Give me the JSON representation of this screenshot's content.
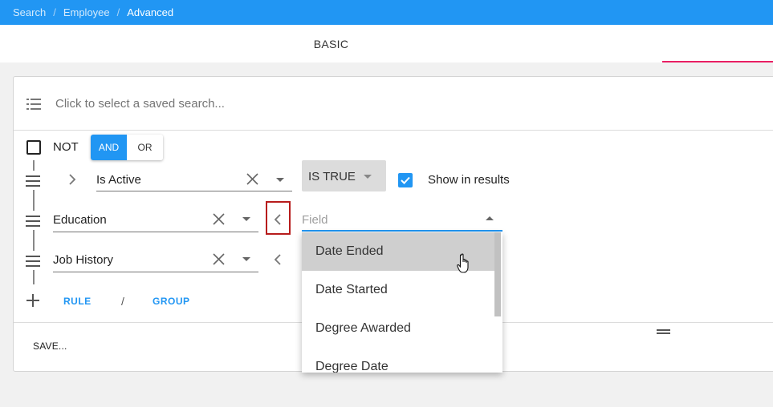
{
  "breadcrumb": {
    "items": [
      "Search",
      "Employee",
      "Advanced"
    ],
    "separator": "/"
  },
  "tabs": {
    "basic": "BASIC",
    "advanced": ""
  },
  "saved_search": {
    "placeholder": "Click to select a saved search...",
    "icon": "list-icon"
  },
  "group": {
    "not_label": "NOT",
    "and_label": "AND",
    "or_label": "OR",
    "and_selected": true
  },
  "rules": [
    {
      "field": "Is Active",
      "operator": "IS TRUE",
      "show_in_results": true,
      "show_label": "Show in results"
    },
    {
      "field": "Education",
      "subfield_placeholder": "Field"
    },
    {
      "field": "Job History"
    }
  ],
  "dropdown": {
    "options": [
      "Date Ended",
      "Date Started",
      "Degree Awarded",
      "Degree Date"
    ],
    "hovered": "Date Ended"
  },
  "actions": {
    "rule": "RULE",
    "separator": "/",
    "group": "GROUP",
    "save": "SAVE..."
  },
  "colors": {
    "primary": "#2196f3",
    "accent": "#e91e63",
    "highlight_border": "#b71c1c"
  }
}
